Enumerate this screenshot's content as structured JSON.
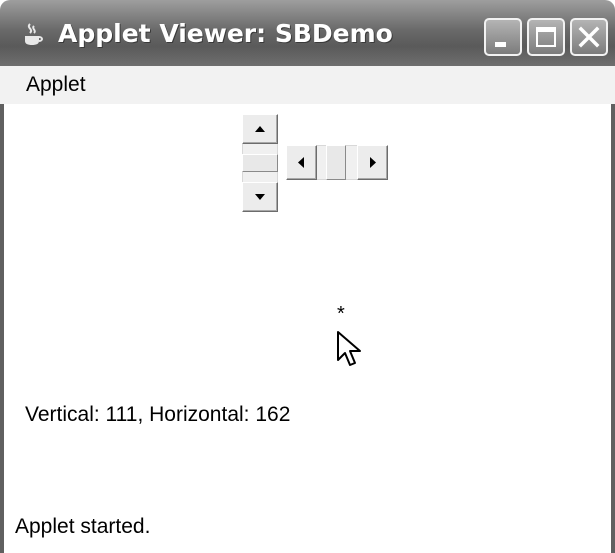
{
  "window": {
    "title": "Applet Viewer: SBDemo",
    "icon": "java-icon",
    "controls": [
      "minimize-icon",
      "maximize-icon",
      "close-icon"
    ]
  },
  "menubar": {
    "items": [
      {
        "label": "Applet"
      }
    ]
  },
  "applet": {
    "vertical_scrollbar": {
      "value": 111
    },
    "horizontal_scrollbar": {
      "value": 162
    },
    "mouse_marker": "*",
    "status_line": "Vertical: 111,  Horizontal: 162"
  },
  "status_bar": {
    "text": "Applet started."
  },
  "colors": {
    "titlebar": "#6a6a6a",
    "menubar": "#f2f2f2",
    "background": "#ffffff"
  }
}
